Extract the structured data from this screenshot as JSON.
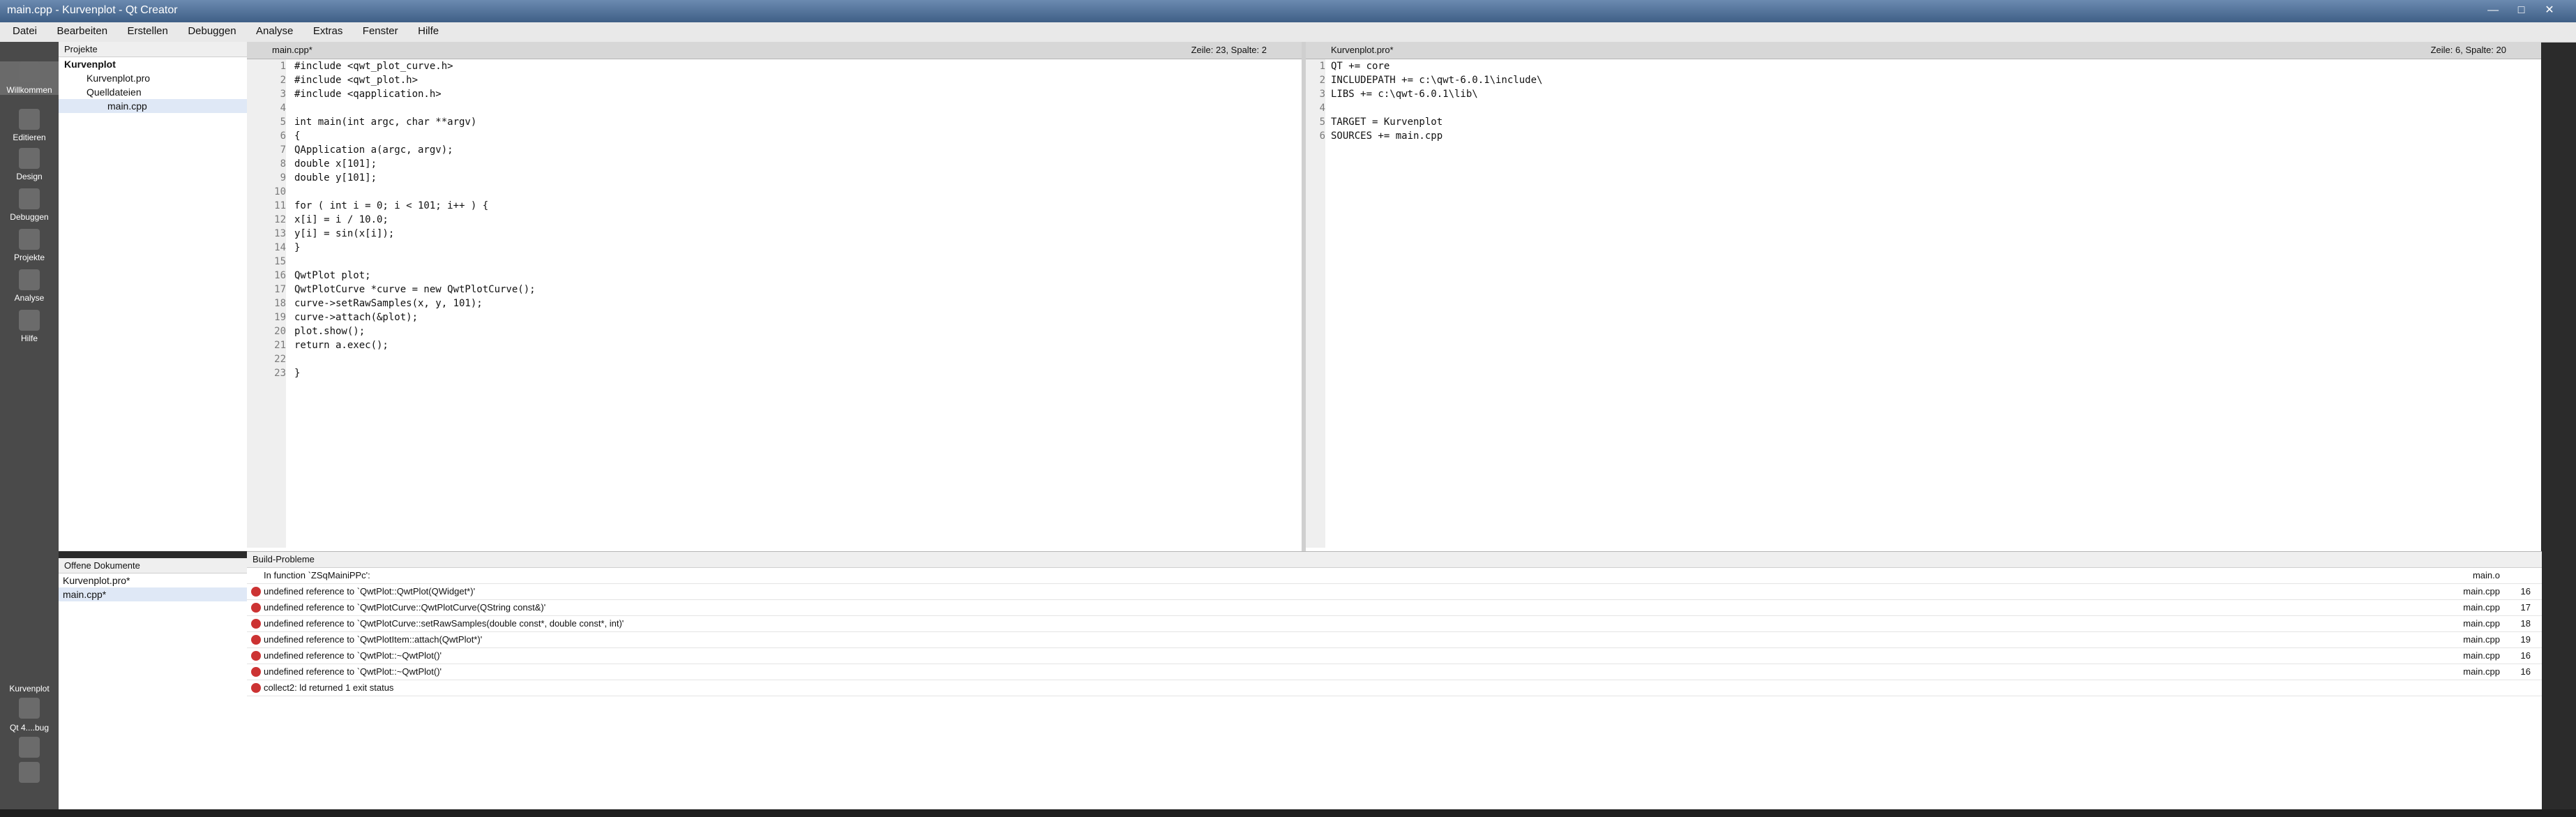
{
  "window": {
    "title": "main.cpp - Kurvenplot - Qt Creator"
  },
  "menubar": [
    "Datei",
    "Bearbeiten",
    "Erstellen",
    "Debuggen",
    "Analyse",
    "Extras",
    "Fenster",
    "Hilfe"
  ],
  "modes": [
    {
      "label": "Willkommen",
      "active": true
    },
    {
      "label": "Editieren",
      "active": false
    },
    {
      "label": "Design",
      "active": false
    },
    {
      "label": "Debuggen",
      "active": false
    },
    {
      "label": "Projekte",
      "active": false
    },
    {
      "label": "Analyse",
      "active": false
    },
    {
      "label": "Hilfe",
      "active": false
    }
  ],
  "projects": {
    "header": "Projekte",
    "items": [
      "Kurvenplot",
      "Kurvenplot.pro",
      "Quelldateien",
      "main.cpp"
    ]
  },
  "editor_left": {
    "filename": "main.cpp*",
    "position": "Zeile: 23, Spalte: 2",
    "lines": [
      "#include <qwt_plot_curve.h>",
      "#include <qwt_plot.h>",
      "#include <qapplication.h>",
      "",
      "int main(int argc, char **argv)",
      "{",
      "    QApplication a(argc, argv);",
      "    double x[101];",
      "    double y[101];",
      "",
      "    for ( int i = 0; i < 101; i++ ) {",
      "        x[i] =  i / 10.0;",
      "        y[i] = sin(x[i]);",
      "    }",
      "",
      "    QwtPlot plot;",
      "    QwtPlotCurve *curve = new QwtPlotCurve();",
      "   curve->setRawSamples(x, y, 101);",
      "   curve->attach(&plot);",
      "    plot.show();",
      "   return a.exec();",
      "",
      "}"
    ]
  },
  "editor_right": {
    "filename": "Kurvenplot.pro*",
    "position": "Zeile: 6, Spalte: 20",
    "lines": [
      "QT += core",
      "INCLUDEPATH += c:\\qwt-6.0.1\\include\\",
      "LIBS += c:\\qwt-6.0.1\\lib\\",
      "",
      "TARGET = Kurvenplot",
      "SOURCES += main.cpp"
    ]
  },
  "open_documents": {
    "header": "Offene Dokumente",
    "items": [
      "Kurvenplot.pro*",
      "main.cpp*"
    ]
  },
  "build_issues": {
    "header": "Build-Probleme",
    "issues": [
      {
        "message": "In function `ZSqMainiPPc':",
        "file": "main.o",
        "line": ""
      },
      {
        "message": "undefined reference to `QwtPlot::QwtPlot(QWidget*)'",
        "file": "main.cpp",
        "line": "16"
      },
      {
        "message": "undefined reference to `QwtPlotCurve::QwtPlotCurve(QString const&)'",
        "file": "main.cpp",
        "line": "17"
      },
      {
        "message": "undefined reference to `QwtPlotCurve::setRawSamples(double const*, double const*, int)'",
        "file": "main.cpp",
        "line": "18"
      },
      {
        "message": "undefined reference to `QwtPlotItem::attach(QwtPlot*)'",
        "file": "main.cpp",
        "line": "19"
      },
      {
        "message": "undefined reference to `QwtPlot::~QwtPlot()'",
        "file": "main.cpp",
        "line": "16"
      },
      {
        "message": "undefined reference to `QwtPlot::~QwtPlot()'",
        "file": "main.cpp",
        "line": "16"
      },
      {
        "message": "collect2: ld returned 1 exit status",
        "file": "",
        "line": ""
      }
    ]
  },
  "kit": {
    "project": "Kurvenplot",
    "config": "Qt 4....bug"
  }
}
